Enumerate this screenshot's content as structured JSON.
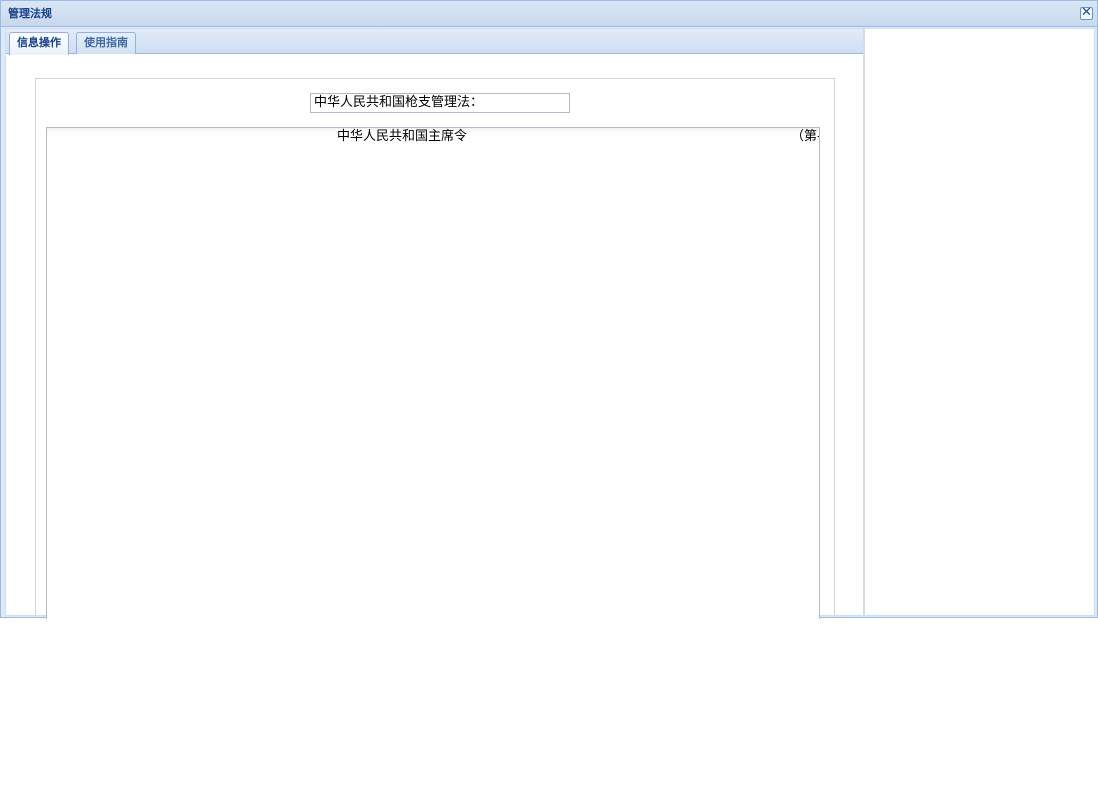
{
  "window": {
    "title": "管理法规",
    "close_glyph": "✕"
  },
  "tabs": [
    {
      "label": "信息操作",
      "active": true
    },
    {
      "label": "使用指南",
      "active": false
    }
  ],
  "form": {
    "law_title_value": "中华人民共和国枪支管理法：",
    "textarea_line1": "中华人民共和国主席令",
    "textarea_line1_right": "（第-"
  },
  "colors": {
    "title_text": "#15428b",
    "border": "#99bbe8",
    "frame_bg": "#dfe8f6"
  }
}
